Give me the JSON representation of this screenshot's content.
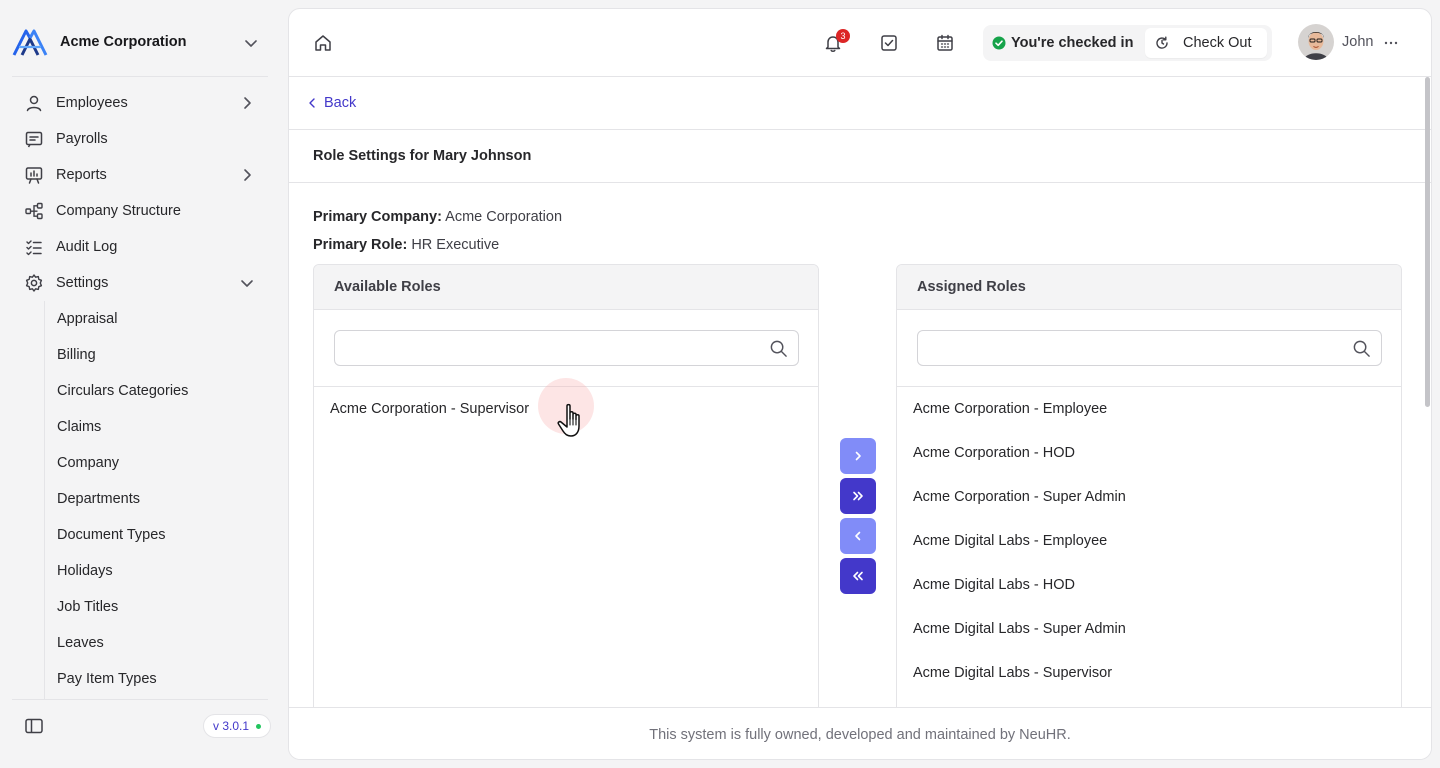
{
  "company": {
    "name": "Acme Corporation"
  },
  "sidebar": {
    "items": [
      {
        "label": "Employees"
      },
      {
        "label": "Payrolls"
      },
      {
        "label": "Reports"
      },
      {
        "label": "Company Structure"
      },
      {
        "label": "Audit Log"
      },
      {
        "label": "Settings"
      }
    ],
    "settings_items": [
      {
        "label": "Appraisal"
      },
      {
        "label": "Billing"
      },
      {
        "label": "Circulars Categories"
      },
      {
        "label": "Claims"
      },
      {
        "label": "Company"
      },
      {
        "label": "Departments"
      },
      {
        "label": "Document Types"
      },
      {
        "label": "Holidays"
      },
      {
        "label": "Job Titles"
      },
      {
        "label": "Leaves"
      },
      {
        "label": "Pay Item Types"
      }
    ],
    "version": "v 3.0.1"
  },
  "header": {
    "notification_count": "3",
    "checkin_status": "You're checked in",
    "checkout_label": "Check Out",
    "user_name": "John"
  },
  "page": {
    "back_label": "Back",
    "title": "Role Settings for Mary Johnson",
    "primary_company_label": "Primary Company:",
    "primary_company_value": "Acme Corporation",
    "primary_role_label": "Primary Role:",
    "primary_role_value": "HR Executive"
  },
  "available": {
    "title": "Available Roles",
    "search_placeholder": "",
    "roles": [
      {
        "label": "Acme Corporation - Supervisor"
      }
    ]
  },
  "assigned": {
    "title": "Assigned Roles",
    "search_placeholder": "",
    "roles": [
      {
        "label": "Acme Corporation - Employee"
      },
      {
        "label": "Acme Corporation - HOD"
      },
      {
        "label": "Acme Corporation - Super Admin"
      },
      {
        "label": "Acme Digital Labs - Employee"
      },
      {
        "label": "Acme Digital Labs - HOD"
      },
      {
        "label": "Acme Digital Labs - Super Admin"
      },
      {
        "label": "Acme Digital Labs - Supervisor"
      }
    ]
  },
  "footer": {
    "text": "This system is fully owned, developed and maintained by NeuHR."
  },
  "colors": {
    "accent": "#4338ca",
    "accent_light": "#818cf8",
    "badge": "#dc2626",
    "checked_in": "#16a34a"
  },
  "icons": [
    "acme-logo-icon",
    "chevron-down-icon",
    "user-icon",
    "chevron-right-icon",
    "payroll-icon",
    "reports-icon",
    "structure-icon",
    "audit-log-icon",
    "gear-icon",
    "sidebar-toggle-icon",
    "home-icon",
    "bell-icon",
    "task-check-icon",
    "calendar-icon",
    "check-circle-icon",
    "clock-out-icon",
    "more-icon",
    "chevron-left-icon",
    "search-icon",
    "move-right-icon",
    "move-all-right-icon",
    "move-left-icon",
    "move-all-left-icon",
    "hand-pointer-icon"
  ]
}
